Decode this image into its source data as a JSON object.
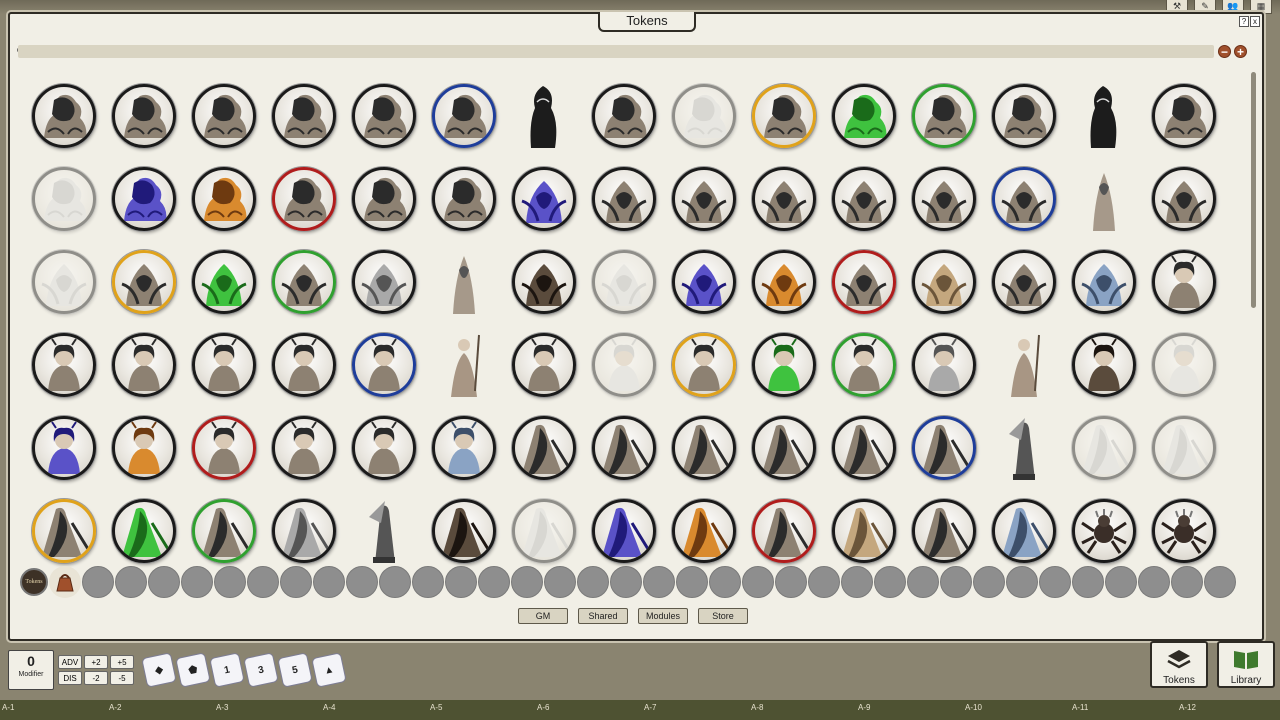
{
  "window": {
    "title": "Tokens",
    "win_btns": [
      "?",
      "x"
    ]
  },
  "search": {
    "placeholder": ""
  },
  "zoom": {
    "minus": "−",
    "plus": "+"
  },
  "tokens": [
    {
      "style": "shadow",
      "ring": "#1a1a1a"
    },
    {
      "style": "shadow",
      "ring": "#1a1a1a"
    },
    {
      "style": "shadow",
      "ring": "#1a1a1a"
    },
    {
      "style": "shadow",
      "ring": "#1a1a1a"
    },
    {
      "style": "shadow",
      "ring": "#1a1a1a"
    },
    {
      "style": "shadow",
      "ring": "#1e3d9a"
    },
    {
      "style": "figure-shadow",
      "ring": ""
    },
    {
      "style": "shadow",
      "ring": "#1a1a1a"
    },
    {
      "style": "shadow-faded",
      "ring": "#1a1a1a"
    },
    {
      "style": "shadow",
      "ring": "#e0a21a"
    },
    {
      "style": "shadow-green",
      "ring": "#1a1a1a"
    },
    {
      "style": "shadow",
      "ring": "#2fa02f"
    },
    {
      "style": "shadow",
      "ring": "#1a1a1a"
    },
    {
      "style": "figure-shadow",
      "ring": ""
    },
    {
      "style": "shadow",
      "ring": "#1a1a1a"
    },
    {
      "style": "shadow-faded",
      "ring": "#1a1a1a"
    },
    {
      "style": "shadow-blue",
      "ring": "#1a1a1a"
    },
    {
      "style": "shadow-orange",
      "ring": "#1a1a1a"
    },
    {
      "style": "shadow",
      "ring": "#b01c1c"
    },
    {
      "style": "shadow",
      "ring": "#1a1a1a"
    },
    {
      "style": "shadow",
      "ring": "#1a1a1a"
    },
    {
      "style": "hooded-blue",
      "ring": "#1a1a1a"
    },
    {
      "style": "hooded",
      "ring": "#1a1a1a"
    },
    {
      "style": "hooded",
      "ring": "#1a1a1a"
    },
    {
      "style": "hooded",
      "ring": "#1a1a1a"
    },
    {
      "style": "hooded",
      "ring": "#1a1a1a"
    },
    {
      "style": "hooded",
      "ring": "#1a1a1a"
    },
    {
      "style": "hooded",
      "ring": "#1e3d9a"
    },
    {
      "style": "figure-hooded",
      "ring": ""
    },
    {
      "style": "hooded",
      "ring": "#1a1a1a"
    },
    {
      "style": "hooded-faded",
      "ring": "#1a1a1a"
    },
    {
      "style": "hooded",
      "ring": "#e0a21a"
    },
    {
      "style": "hooded-green",
      "ring": "#1a1a1a"
    },
    {
      "style": "hooded",
      "ring": "#2fa02f"
    },
    {
      "style": "hooded-grey",
      "ring": "#1a1a1a"
    },
    {
      "style": "figure-hooded",
      "ring": ""
    },
    {
      "style": "hooded-dark",
      "ring": "#1a1a1a"
    },
    {
      "style": "hooded-faded",
      "ring": "#1a1a1a"
    },
    {
      "style": "hooded-blue",
      "ring": "#1a1a1a"
    },
    {
      "style": "hooded-orange",
      "ring": "#1a1a1a"
    },
    {
      "style": "hooded",
      "ring": "#b01c1c"
    },
    {
      "style": "hooded-tan",
      "ring": "#1a1a1a"
    },
    {
      "style": "hooded",
      "ring": "#1a1a1a"
    },
    {
      "style": "hooded-steel",
      "ring": "#1a1a1a"
    },
    {
      "style": "woman",
      "ring": "#1a1a1a"
    },
    {
      "style": "woman",
      "ring": "#1a1a1a"
    },
    {
      "style": "woman",
      "ring": "#1a1a1a"
    },
    {
      "style": "woman",
      "ring": "#1a1a1a"
    },
    {
      "style": "woman",
      "ring": "#1a1a1a"
    },
    {
      "style": "woman",
      "ring": "#1e3d9a"
    },
    {
      "style": "figure-woman",
      "ring": ""
    },
    {
      "style": "woman",
      "ring": "#1a1a1a"
    },
    {
      "style": "woman-faded",
      "ring": "#1a1a1a"
    },
    {
      "style": "woman",
      "ring": "#e0a21a"
    },
    {
      "style": "woman-green",
      "ring": "#1a1a1a"
    },
    {
      "style": "woman",
      "ring": "#2fa02f"
    },
    {
      "style": "woman-grey",
      "ring": "#1a1a1a"
    },
    {
      "style": "figure-woman",
      "ring": ""
    },
    {
      "style": "woman-dark",
      "ring": "#1a1a1a"
    },
    {
      "style": "woman-faded",
      "ring": "#1a1a1a"
    },
    {
      "style": "woman-blue",
      "ring": "#1a1a1a"
    },
    {
      "style": "woman-orange",
      "ring": "#1a1a1a"
    },
    {
      "style": "woman",
      "ring": "#b01c1c"
    },
    {
      "style": "woman",
      "ring": "#1a1a1a"
    },
    {
      "style": "woman",
      "ring": "#1a1a1a"
    },
    {
      "style": "woman-steel",
      "ring": "#1a1a1a"
    },
    {
      "style": "wraith",
      "ring": "#1a1a1a"
    },
    {
      "style": "wraith",
      "ring": "#1a1a1a"
    },
    {
      "style": "wraith",
      "ring": "#1a1a1a"
    },
    {
      "style": "wraith",
      "ring": "#1a1a1a"
    },
    {
      "style": "wraith",
      "ring": "#1a1a1a"
    },
    {
      "style": "wraith",
      "ring": "#1e3d9a"
    },
    {
      "style": "figure-wraith",
      "ring": ""
    },
    {
      "style": "wraith-faded",
      "ring": "#1a1a1a"
    },
    {
      "style": "wraith-faded",
      "ring": "#1a1a1a"
    },
    {
      "style": "wraith",
      "ring": "#e0a21a"
    },
    {
      "style": "wraith-green",
      "ring": "#1a1a1a"
    },
    {
      "style": "wraith",
      "ring": "#2fa02f"
    },
    {
      "style": "wraith-grey",
      "ring": "#1a1a1a"
    },
    {
      "style": "figure-wraith",
      "ring": ""
    },
    {
      "style": "wraith-dark",
      "ring": "#1a1a1a"
    },
    {
      "style": "wraith-faded",
      "ring": "#1a1a1a"
    },
    {
      "style": "wraith-blue",
      "ring": "#1a1a1a"
    },
    {
      "style": "wraith-orange",
      "ring": "#1a1a1a"
    },
    {
      "style": "wraith",
      "ring": "#b01c1c"
    },
    {
      "style": "wraith-tan",
      "ring": "#1a1a1a"
    },
    {
      "style": "wraith",
      "ring": "#1a1a1a"
    },
    {
      "style": "wraith-steel",
      "ring": "#1a1a1a"
    },
    {
      "style": "spider",
      "ring": "#1a1a1a"
    },
    {
      "style": "spider",
      "ring": "#1a1a1a"
    }
  ],
  "tray": {
    "book_label": "Tokens",
    "empty_slots": 35
  },
  "tabs": [
    "GM",
    "Shared",
    "Modules",
    "Store"
  ],
  "modifier": {
    "value": "0",
    "label": "Modifier"
  },
  "mod_buttons": [
    "ADV",
    "+2",
    "+5",
    "DIS",
    "-2",
    "-5"
  ],
  "dice": [
    "d20",
    "d12",
    "1",
    "3",
    "5",
    "d4"
  ],
  "side_buttons": {
    "tokens": "Tokens",
    "library": "Library"
  },
  "ruler": [
    "A-1",
    "A-2",
    "A-3",
    "A-4",
    "A-5",
    "A-6",
    "A-7",
    "A-8",
    "A-9",
    "A-10",
    "A-11",
    "A-12"
  ],
  "colors": {
    "ring_blue": "#1e3d9a",
    "ring_gold": "#e0a21a",
    "ring_green": "#2fa02f",
    "ring_red": "#b01c1c",
    "zoom": "#a0502c"
  }
}
